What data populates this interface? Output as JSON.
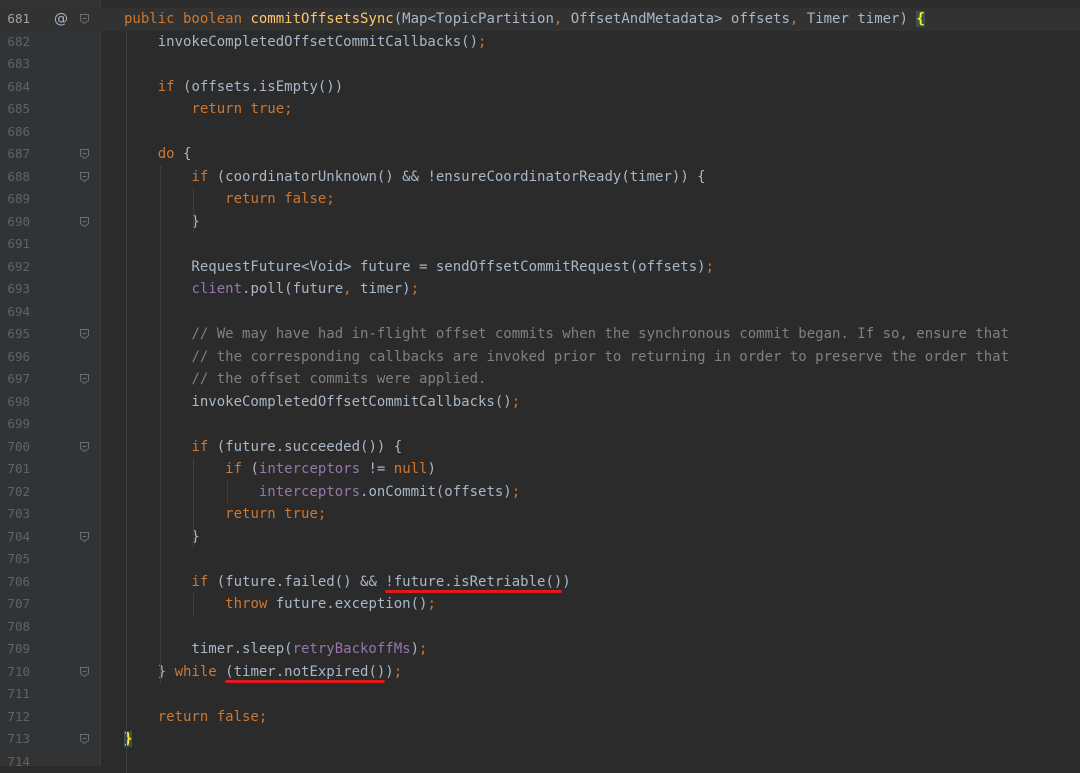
{
  "editor": {
    "current_line": "681",
    "lines": [
      {
        "num": "681",
        "html": "<span class=\"kw\">public boolean </span><span class=\"fn\">commitOffsetsSync</span>(Map&lt;TopicPartition<span class=\"kw\">, </span>OffsetAndMetadata&gt; offsets<span class=\"kw\">, </span>Timer timer) <span class=\"brace-match\">{</span>"
      },
      {
        "num": "682",
        "html": "    invokeCompletedOffsetCommitCallbacks()<span class=\"kw\">;</span>"
      },
      {
        "num": "683",
        "html": ""
      },
      {
        "num": "684",
        "html": "    <span class=\"kw\">if </span>(offsets.isEmpty())"
      },
      {
        "num": "685",
        "html": "        <span class=\"kw\">return true;</span>"
      },
      {
        "num": "686",
        "html": ""
      },
      {
        "num": "687",
        "html": "    <span class=\"kw\">do </span>{"
      },
      {
        "num": "688",
        "html": "        <span class=\"kw\">if </span>(coordinatorUnknown() &amp;&amp; !ensureCoordinatorReady(timer)) {"
      },
      {
        "num": "689",
        "html": "            <span class=\"kw\">return false;</span>"
      },
      {
        "num": "690",
        "html": "        }"
      },
      {
        "num": "691",
        "html": ""
      },
      {
        "num": "692",
        "html": "        RequestFuture&lt;Void&gt; future = sendOffsetCommitRequest(offsets)<span class=\"kw\">;</span>"
      },
      {
        "num": "693",
        "html": "        <span class=\"fld\">client</span>.poll(future<span class=\"kw\">, </span>timer)<span class=\"kw\">;</span>"
      },
      {
        "num": "694",
        "html": ""
      },
      {
        "num": "695",
        "html": "        <span class=\"cmt\">// We may have had in-flight offset commits when the synchronous commit began. If so, ensure that</span>"
      },
      {
        "num": "696",
        "html": "        <span class=\"cmt\">// the corresponding callbacks are invoked prior to returning in order to preserve the order that</span>"
      },
      {
        "num": "697",
        "html": "        <span class=\"cmt\">// the offset commits were applied.</span>"
      },
      {
        "num": "698",
        "html": "        invokeCompletedOffsetCommitCallbacks()<span class=\"kw\">;</span>"
      },
      {
        "num": "699",
        "html": ""
      },
      {
        "num": "700",
        "html": "        <span class=\"kw\">if </span>(future.succeeded()) {"
      },
      {
        "num": "701",
        "html": "            <span class=\"kw\">if </span>(<span class=\"fld\">interceptors </span>!= <span class=\"kw\">null</span>)"
      },
      {
        "num": "702",
        "html": "                <span class=\"fld\">interceptors</span>.onCommit(offsets)<span class=\"kw\">;</span>"
      },
      {
        "num": "703",
        "html": "            <span class=\"kw\">return true;</span>"
      },
      {
        "num": "704",
        "html": "        }"
      },
      {
        "num": "705",
        "html": ""
      },
      {
        "num": "706",
        "html": "        <span class=\"kw\">if </span>(future.failed() &amp;&amp; !future.isRetriable())"
      },
      {
        "num": "707",
        "html": "            <span class=\"kw\">throw </span>future.exception()<span class=\"kw\">;</span>"
      },
      {
        "num": "708",
        "html": ""
      },
      {
        "num": "709",
        "html": "        timer.sleep(<span class=\"fld\">retryBackoffMs</span>)<span class=\"kw\">;</span>"
      },
      {
        "num": "710",
        "html": "    } <span class=\"kw\">while </span>(timer.notExpired())<span class=\"kw\">;</span>"
      },
      {
        "num": "711",
        "html": ""
      },
      {
        "num": "712",
        "html": "    <span class=\"kw\">return false;</span>"
      },
      {
        "num": "713",
        "html": "<span class=\"brace-match\">}</span>"
      },
      {
        "num": "714",
        "html": ""
      }
    ],
    "gutter_icon": "@",
    "gutter_icon_name": "override-annotation-icon",
    "fold_markers": [
      "681",
      "687",
      "688",
      "690",
      "695",
      "697",
      "700",
      "704",
      "710",
      "713"
    ],
    "underlines": [
      {
        "line": "706",
        "text": "!future.isRetriable()"
      },
      {
        "line": "710",
        "text": "(timer.notExpired()"
      }
    ],
    "colors": {
      "background": "#2b2b2b",
      "keyword": "#cc7832",
      "method_decl": "#ffc66d",
      "field": "#9876aa",
      "comment": "#808080",
      "text": "#a9b7c6",
      "underline": "#e0191d"
    }
  }
}
